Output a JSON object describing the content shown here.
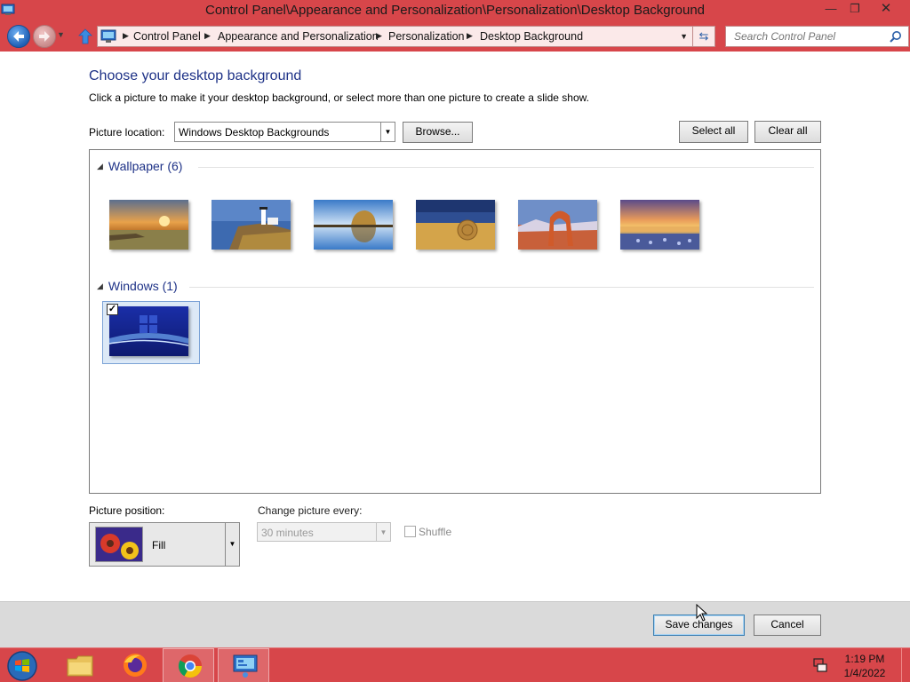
{
  "window": {
    "title": "Control Panel\\Appearance and Personalization\\Personalization\\Desktop Background",
    "controls": {
      "minimize": "—",
      "maximize": "❐",
      "close": "✕"
    }
  },
  "nav": {
    "breadcrumbs": [
      "Control Panel",
      "Appearance and Personalization",
      "Personalization",
      "Desktop Background"
    ],
    "search_placeholder": "Search Control Panel"
  },
  "page": {
    "heading": "Choose your desktop background",
    "subtext": "Click a picture to make it your desktop background, or select more than one picture to create a slide show.",
    "picture_location_label": "Picture location:",
    "picture_location_value": "Windows Desktop Backgrounds",
    "browse_label": "Browse...",
    "select_all_label": "Select all",
    "clear_all_label": "Clear all"
  },
  "groups": [
    {
      "name": "Wallpaper (6)",
      "thumbnails": [
        {
          "icon": "sunset-field-wallpaper",
          "selected": false
        },
        {
          "icon": "lighthouse-wallpaper",
          "selected": false
        },
        {
          "icon": "rock-reflection-wallpaper",
          "selected": false
        },
        {
          "icon": "hay-bale-wallpaper",
          "selected": false
        },
        {
          "icon": "rock-arch-wallpaper",
          "selected": false
        },
        {
          "icon": "flower-lake-sunset-wallpaper",
          "selected": false
        }
      ]
    },
    {
      "name": "Windows (1)",
      "thumbnails": [
        {
          "icon": "windows-default-wallpaper",
          "selected": true
        }
      ]
    }
  ],
  "options": {
    "picture_position_label": "Picture position:",
    "picture_position_value": "Fill",
    "change_picture_label": "Change picture every:",
    "change_picture_value": "30 minutes",
    "shuffle_label": "Shuffle",
    "shuffle_checked": false
  },
  "footer": {
    "save_label": "Save changes",
    "cancel_label": "Cancel"
  },
  "taskbar": {
    "apps": [
      "file-explorer-icon",
      "firefox-icon",
      "chrome-icon",
      "control-panel-icon"
    ],
    "active_app": "control-panel-icon",
    "clock_time": "1:19 PM",
    "clock_date": "1/4/2022"
  },
  "colors": {
    "accent": "#d7464a",
    "heading": "#1e3287"
  }
}
